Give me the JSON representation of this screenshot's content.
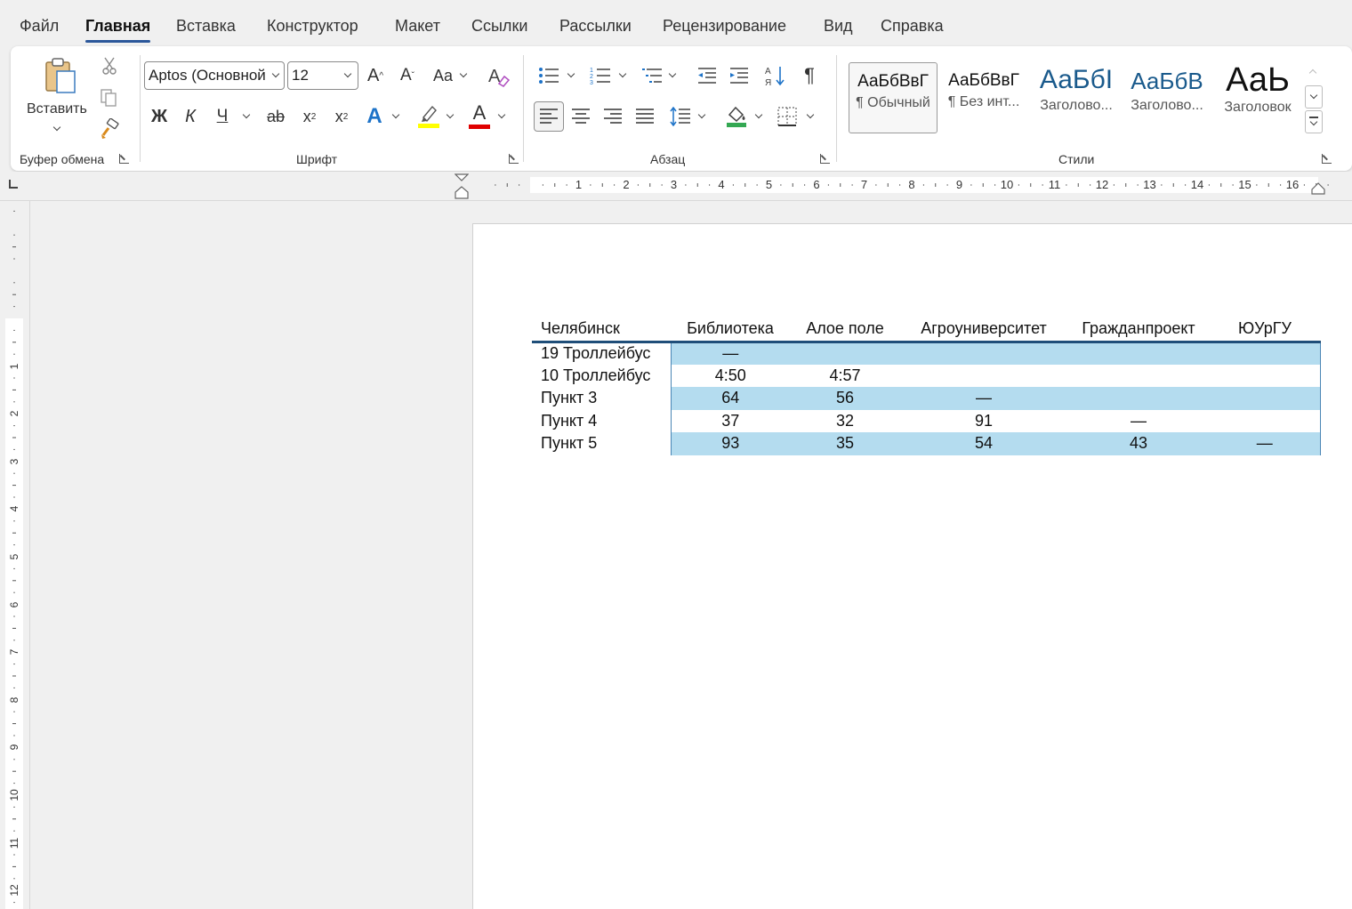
{
  "tabs": [
    "Файл",
    "Главная",
    "Вставка",
    "Конструктор",
    "Макет",
    "Ссылки",
    "Рассылки",
    "Рецензирование",
    "Вид",
    "Справка"
  ],
  "active_tab": "Главная",
  "ribbon": {
    "clipboard": {
      "paste_label": "Вставить",
      "group_label": "Буфер обмена"
    },
    "font": {
      "font_name": "Aptos (Основной",
      "font_size": "12",
      "bold": "Ж",
      "italic": "К",
      "underline": "Ч",
      "strike": "ab",
      "subscript": "x",
      "superscript": "x",
      "text_effect": "A",
      "font_color_letter": "A",
      "grow": "A",
      "shrink": "A",
      "case": "Aa",
      "group_label": "Шрифт",
      "highlight_color": "#ffff00",
      "font_color": "#e00000"
    },
    "paragraph": {
      "group_label": "Абзац",
      "pilcrow": "¶"
    },
    "styles": {
      "group_label": "Стили",
      "items": [
        {
          "sample": "АаБбВвГ",
          "name": "¶ Обычный"
        },
        {
          "sample": "АаБбВвГ",
          "name": "¶ Без инт..."
        },
        {
          "sample": "АаБбI",
          "name": "Заголово..."
        },
        {
          "sample": "АаБбВ",
          "name": "Заголово..."
        },
        {
          "sample": "АаЬ",
          "name": "Заголовок"
        }
      ]
    }
  },
  "ruler": {
    "h_numbers": [
      "1",
      "2",
      "3",
      "4",
      "5",
      "6",
      "7",
      "8",
      "9",
      "10",
      "11",
      "12",
      "13",
      "14",
      "15",
      "16"
    ],
    "v_numbers": [
      "1",
      "2",
      "3",
      "4",
      "5",
      "6",
      "7",
      "8",
      "9",
      "10",
      "11",
      "12"
    ]
  },
  "table": {
    "headers": [
      "Челябинск",
      "Библиотека",
      "Алое поле",
      "Агроуниверситет",
      "Гражданпроект",
      "ЮУрГУ"
    ],
    "rows": [
      [
        "19 Троллейбус",
        "—",
        "",
        "",
        "",
        ""
      ],
      [
        "10 Троллейбус",
        "4:50",
        "4:57",
        "",
        "",
        ""
      ],
      [
        "Пункт 3",
        "64",
        "56",
        "—",
        "",
        ""
      ],
      [
        "Пункт 4",
        "37",
        "32",
        "91",
        "—",
        ""
      ],
      [
        "Пункт 5",
        "93",
        "35",
        "54",
        "43",
        "—"
      ]
    ]
  },
  "colors": {
    "accent": "#2b579a",
    "band": "#b4dcef",
    "table_rule": "#1f4e79"
  }
}
